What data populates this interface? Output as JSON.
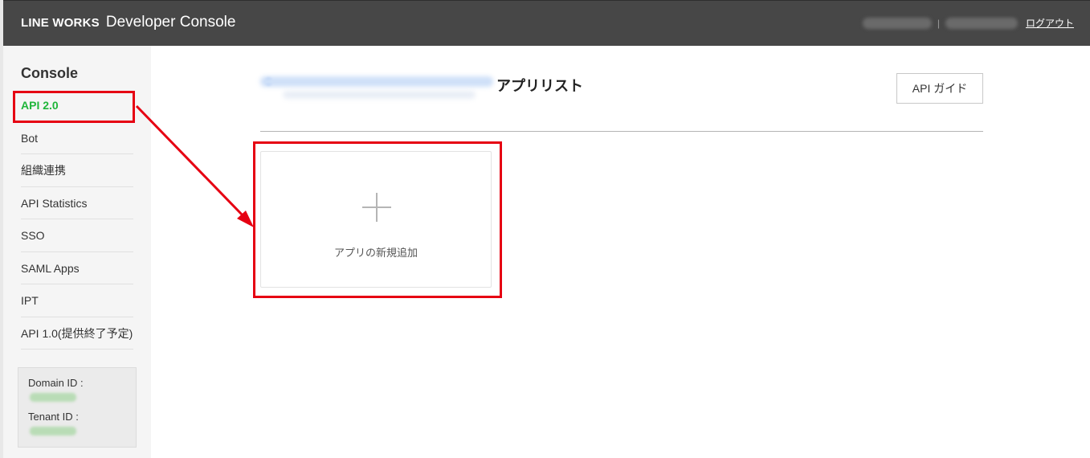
{
  "header": {
    "brand_logo": "LINE WORKS",
    "brand_name": "Developer Console",
    "separator": "|",
    "logout_label": "ログアウト"
  },
  "sidebar": {
    "title": "Console",
    "items": [
      {
        "label": "API 2.0",
        "active": true
      },
      {
        "label": "Bot"
      },
      {
        "label": "組織連携"
      },
      {
        "label": "API Statistics"
      },
      {
        "label": "SSO"
      },
      {
        "label": "SAML Apps"
      },
      {
        "label": "IPT"
      },
      {
        "label": "API 1.0(提供終了予定)"
      }
    ],
    "domain_id_label": "Domain ID :",
    "tenant_id_label": "Tenant ID :"
  },
  "main": {
    "title": "アプリリスト",
    "api_guide_label": "API ガイド",
    "add_app_label": "アプリの新規追加"
  },
  "colors": {
    "header_bg": "#474747",
    "active_nav": "#1fb53a",
    "highlight": "#e60012"
  },
  "icons": {
    "add": "plus-icon"
  }
}
